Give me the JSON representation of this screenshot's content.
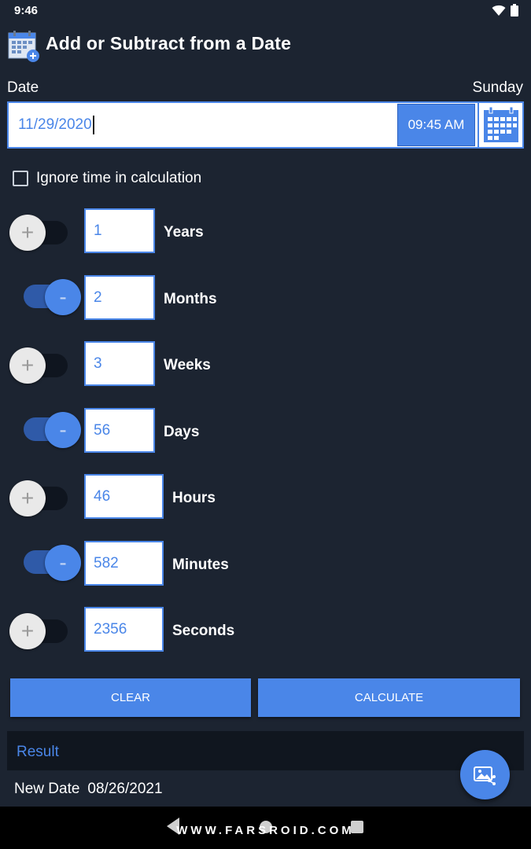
{
  "status_bar": {
    "time": "9:46",
    "icons": [
      "wifi-icon",
      "battery-icon"
    ]
  },
  "header": {
    "title": "Add or Subtract from a Date",
    "logo_icon": "calendar-plus-icon"
  },
  "date_section": {
    "label": "Date",
    "day": "Sunday",
    "date_value": "11/29/2020",
    "time_value": "09:45 AM",
    "calendar_icon": "calendar-icon"
  },
  "ignore_time": {
    "label": "Ignore time in calculation",
    "checked": false
  },
  "units": [
    {
      "mode": "add",
      "symbol": "+",
      "value": "1",
      "label": "Years"
    },
    {
      "mode": "subtract",
      "symbol": "-",
      "value": "2",
      "label": "Months"
    },
    {
      "mode": "add",
      "symbol": "+",
      "value": "3",
      "label": "Weeks"
    },
    {
      "mode": "subtract",
      "symbol": "-",
      "value": "56",
      "label": "Days"
    },
    {
      "mode": "add",
      "symbol": "+",
      "value": "46",
      "label": "Hours"
    },
    {
      "mode": "subtract",
      "symbol": "-",
      "value": "582",
      "label": "Minutes"
    },
    {
      "mode": "add",
      "symbol": "+",
      "value": "2356",
      "label": "Seconds"
    }
  ],
  "buttons": {
    "clear": "CLEAR",
    "calculate": "CALCULATE"
  },
  "result": {
    "header": "Result",
    "new_date_label": "New Date",
    "new_date_value": "08/26/2021"
  },
  "fab_icon": "share-image-icon",
  "watermark": "WWW.FARSROID.COM",
  "colors": {
    "background": "#1c2431",
    "accent": "#4a86e8",
    "result_bg": "#10161f"
  }
}
